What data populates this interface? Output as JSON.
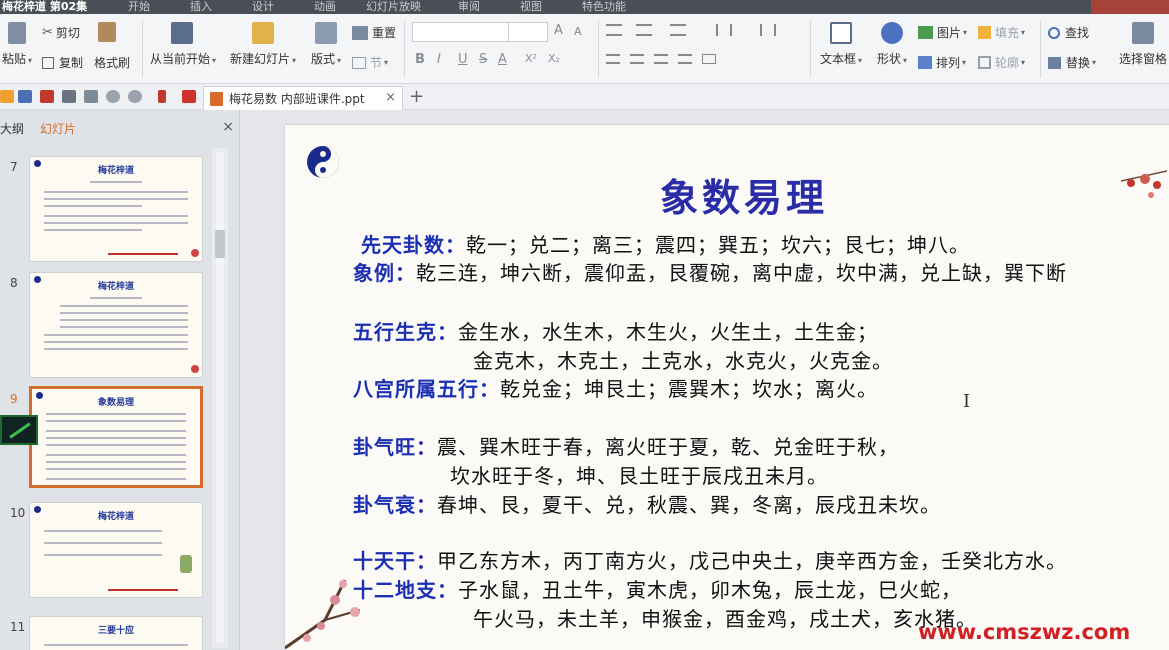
{
  "window": {
    "title": "梅花梓道 第02集",
    "menus": [
      "开始",
      "插入",
      "设计",
      "动画",
      "幻灯片放映",
      "审阅",
      "视图",
      "特色功能"
    ]
  },
  "ribbon": {
    "paste": "粘贴",
    "cut": "剪切",
    "copy": "复制",
    "format_painter": "格式刷",
    "from_start": "从当前开始",
    "new_slide": "新建幻灯片",
    "layout": "版式",
    "reset": "重置",
    "section": "节",
    "bold": "B",
    "italic": "I",
    "underline": "U",
    "strike": "S",
    "text_color": "A",
    "superscript": "X²",
    "subscript": "X₂",
    "grow_font": "A",
    "shrink_font": "A",
    "textbox": "文本框",
    "shape": "形状",
    "picture": "图片",
    "fill": "填充",
    "arrange": "排列",
    "outline": "轮廓",
    "find": "查找",
    "replace": "替换",
    "select_pane": "选择窗格"
  },
  "tabs": {
    "doc_name": "梅花易数 内部班课件.ppt",
    "close": "×",
    "new": "+"
  },
  "panel": {
    "tab_outline": "大纲",
    "tab_slides": "幻灯片",
    "close": "×",
    "slides": [
      {
        "number": "7",
        "title": "梅花梓道"
      },
      {
        "number": "8",
        "title": "梅花梓道"
      },
      {
        "number": "9",
        "title": "象数易理"
      },
      {
        "number": "10",
        "title": "梅花梓道"
      },
      {
        "number": "11",
        "title": "三要十应"
      }
    ]
  },
  "slide": {
    "title": "象数易理",
    "lines": [
      {
        "label": "先天卦数：",
        "text": "乾一；兑二；离三；震四；巽五；坎六；艮七；坤八。"
      },
      {
        "label": "象例：",
        "text": "乾三连，坤六断，震仰盂，艮覆碗，离中虚，坎中满，兑上缺，巽下断"
      },
      {
        "label": "五行生克：",
        "text": "金生水，水生木，木生火，火生土，土生金；"
      },
      {
        "label": "",
        "text": "金克木，木克土，土克水，水克火，火克金。"
      },
      {
        "label": "八宫所属五行：",
        "text": "乾兑金；坤艮土；震巽木；坎水；离火。"
      },
      {
        "label": "卦气旺：",
        "text": "震、巽木旺于春，离火旺于夏，乾、兑金旺于秋，"
      },
      {
        "label": "",
        "text": "坎水旺于冬，坤、艮土旺于辰戌丑未月。"
      },
      {
        "label": "卦气衰：",
        "text": "春坤、艮，夏干、兑，秋震、巽，冬离，辰戌丑未坎。"
      },
      {
        "label": "十天干：",
        "text": "甲乙东方木，丙丁南方火，戊己中央土，庚辛西方金，壬癸北方水。"
      },
      {
        "label": "十二地支：",
        "text": "子水鼠，丑土牛，寅木虎，卯木兔，辰土龙，巳火蛇，"
      },
      {
        "label": "",
        "text": "午火马，未土羊，申猴金，酉金鸡，戌土犬，亥水猪。"
      }
    ]
  },
  "watermark": "www.cmszwz.com",
  "colors": {
    "accent": "#d46d2b",
    "title_blue": "#2a2ca8",
    "label_blue": "#1b2fb2",
    "watermark_red": "#d12024"
  }
}
